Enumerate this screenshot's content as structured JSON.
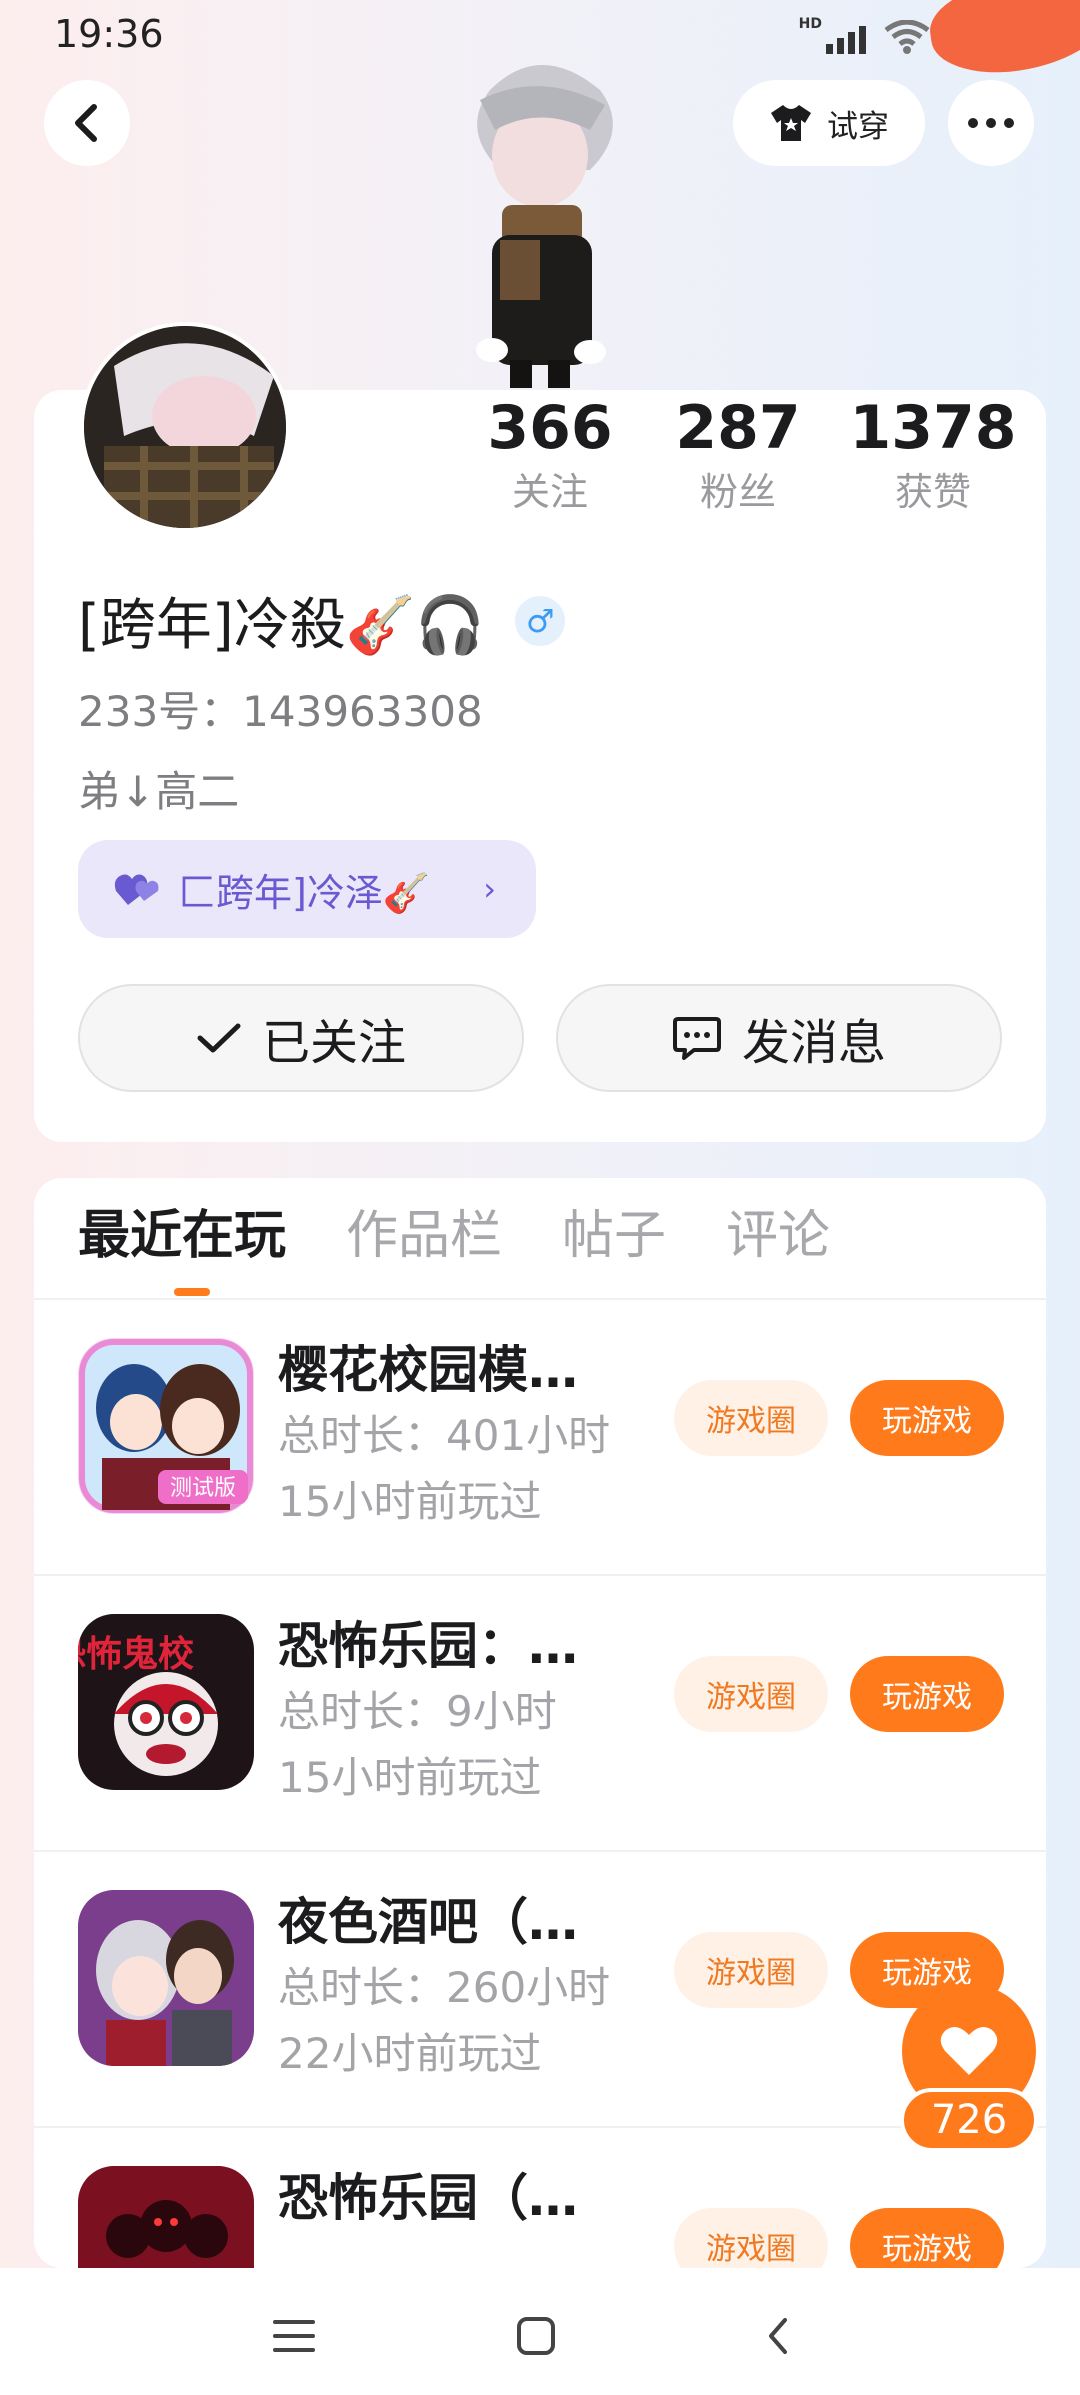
{
  "status_bar": {
    "time": "19:36",
    "hd": "HD"
  },
  "header": {
    "try_on_label": "试穿"
  },
  "stats": [
    {
      "value": "366",
      "label": "关注"
    },
    {
      "value": "287",
      "label": "粉丝"
    },
    {
      "value": "1378",
      "label": "获赞"
    }
  ],
  "profile": {
    "nickname": "[跨年]冷殺🎸🎧",
    "gender_symbol": "♂",
    "uid": "233号：143963308",
    "bio": "弟↓高二",
    "cp_name": "匚跨年]冷泽🎸",
    "cp_chevron": "›"
  },
  "actions": {
    "follow_label": "已关注",
    "message_label": "发消息"
  },
  "tabs": [
    "最近在玩",
    "作品栏",
    "帖子",
    "评论"
  ],
  "games": [
    {
      "title": "樱花校园模…",
      "duration": "总时长：401小时",
      "last_played": "15小时前玩过",
      "circle_label": "游戏圈",
      "play_label": "玩游戏",
      "icon_badge": "测试版"
    },
    {
      "title": "恐怖乐园：…",
      "duration": "总时长：9小时",
      "last_played": "15小时前玩过",
      "circle_label": "游戏圈",
      "play_label": "玩游戏",
      "icon_badge": "恐怖鬼校"
    },
    {
      "title": "夜色酒吧（…",
      "duration": "总时长：260小时",
      "last_played": "22小时前玩过",
      "circle_label": "游戏圈",
      "play_label": "玩游戏"
    },
    {
      "title": "恐怖乐园（…",
      "duration": "",
      "last_played": "",
      "circle_label": "游戏圈",
      "play_label": "玩游戏"
    }
  ],
  "like_float": {
    "count": "726"
  },
  "colors": {
    "accent": "#ff7a1a",
    "cp_purple": "#6a5ad1",
    "male_blue": "#3d9bf5"
  },
  "icons": [
    "back-icon",
    "tshirt-icon",
    "more-icon",
    "heart-icon",
    "check-icon",
    "chat-icon",
    "menu-icon",
    "home-icon",
    "nav-back-icon"
  ]
}
